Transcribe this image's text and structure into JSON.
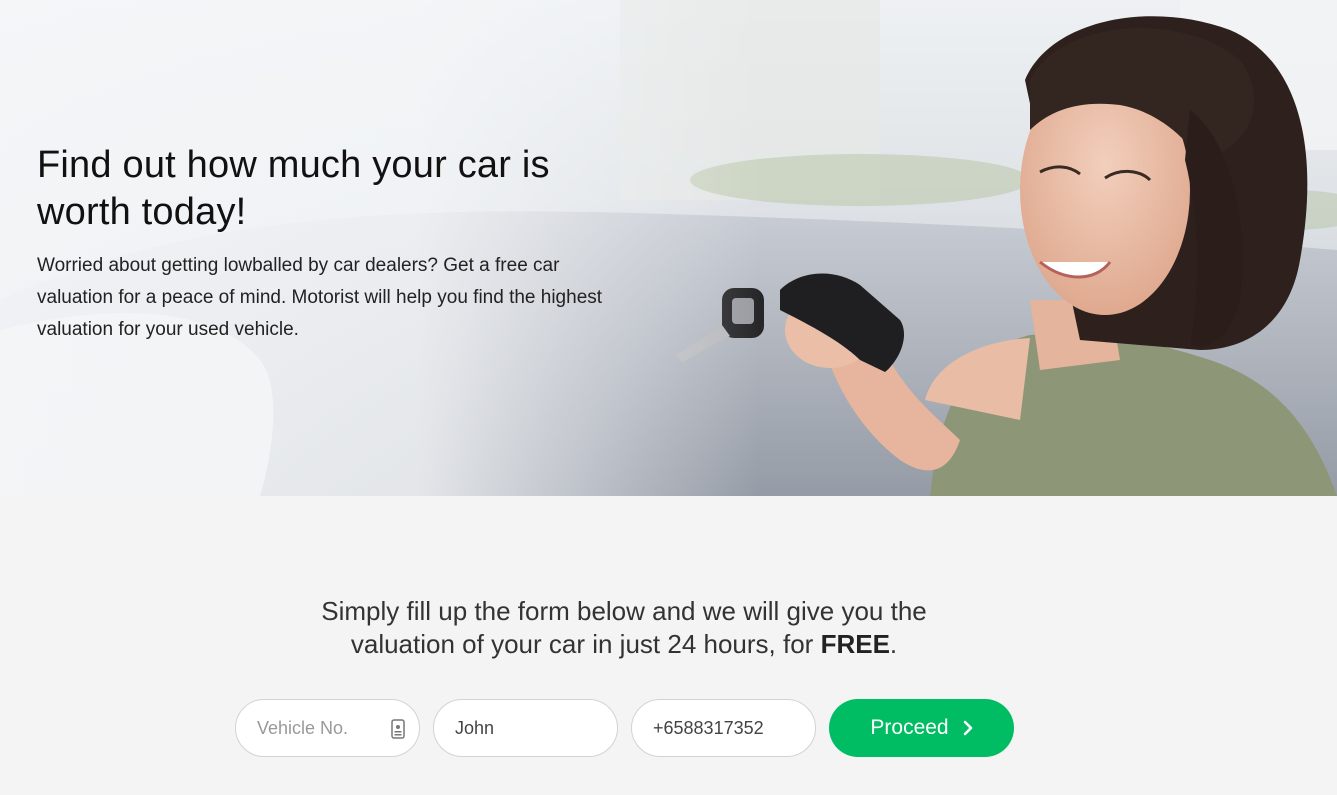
{
  "hero": {
    "title_line1": "Find out how much your car is",
    "title_line2": "worth today!",
    "description": "Worried about getting lowballed by car dealers? Get a free car valuation for a peace of mind. Motorist will help you find the highest valuation for your used vehicle."
  },
  "form": {
    "heading_line1": "Simply fill up the form below and we will give you the",
    "heading_line2_prefix": "valuation of your car in just 24 hours, for ",
    "heading_line2_bold": "FREE",
    "heading_line2_suffix": ".",
    "vehicle_placeholder": "Vehicle No.",
    "name_value": "John",
    "phone_value": "+6588317352",
    "proceed_label": "Proceed",
    "vehicle_icon": "id-card-icon",
    "proceed_icon": "chevron-right-icon"
  },
  "colors": {
    "accent": "#00bd63",
    "page_bg": "#f4f4f4"
  }
}
